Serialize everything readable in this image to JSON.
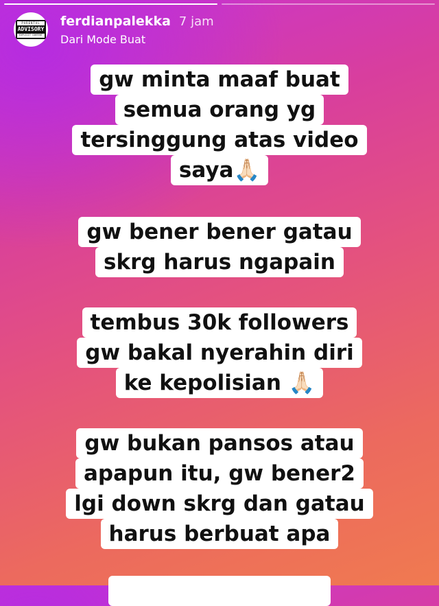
{
  "progress": {
    "segments": 2,
    "active": 0
  },
  "profile": {
    "avatar_badge": {
      "top": "PARENTAL",
      "main": "ADVISORY",
      "bottom": "EXPLICIT CONTENT"
    },
    "username": "ferdianpalekka",
    "time_ago": "7 jam",
    "subtitle": "Dari Mode Buat"
  },
  "text_blocks": [
    {
      "lines": [
        "gw minta maaf buat",
        "semua orang yg",
        "tersinggung atas video",
        "saya🙏🏻"
      ]
    },
    {
      "lines": [
        "gw bener bener gatau",
        "skrg harus ngapain"
      ]
    },
    {
      "lines": [
        "tembus 30k followers",
        "gw bakal nyerahin diri",
        "ke kepolisian 🙏🏻"
      ]
    },
    {
      "lines": [
        "gw bukan pansos atau",
        "apapun itu, gw bener2",
        "lgi down skrg dan gatau",
        "harus berbuat apa"
      ]
    }
  ],
  "colors": {
    "gradient_start": "#b62ce0",
    "gradient_mid": "#e4527e",
    "gradient_end": "#f07a50",
    "label_bg": "#ffffff",
    "label_text": "#111111"
  }
}
